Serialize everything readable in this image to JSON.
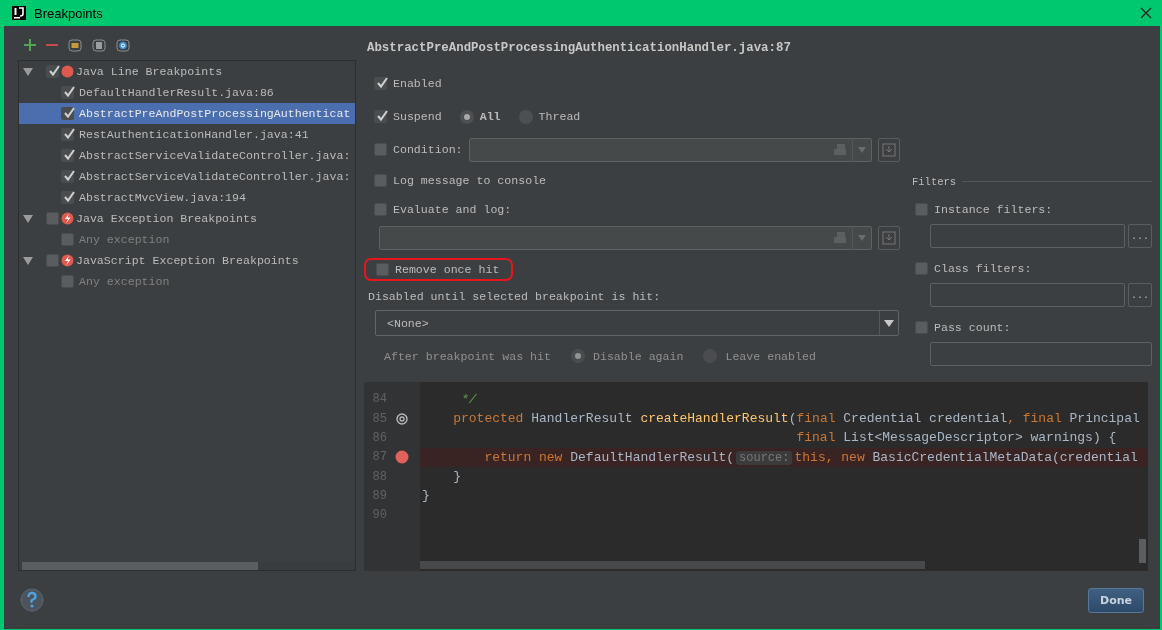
{
  "window": {
    "title": "Breakpoints"
  },
  "tree": [
    {
      "label": "Java Line Breakpoints",
      "kind": "line",
      "checked": true,
      "expanded": true,
      "selected": false,
      "children": [
        {
          "label": "DefaultHandlerResult.java:86",
          "checked": true,
          "selected": false,
          "disabled": false
        },
        {
          "label": "AbstractPreAndPostProcessingAuthenticat",
          "checked": true,
          "selected": true,
          "disabled": false
        },
        {
          "label": "RestAuthenticationHandler.java:41",
          "checked": true,
          "selected": false,
          "disabled": false
        },
        {
          "label": "AbstractServiceValidateController.java:",
          "checked": true,
          "selected": false,
          "disabled": false
        },
        {
          "label": "AbstractServiceValidateController.java:",
          "checked": true,
          "selected": false,
          "disabled": false
        },
        {
          "label": "AbstractMvcView.java:194",
          "checked": true,
          "selected": false,
          "disabled": false
        }
      ]
    },
    {
      "label": "Java Exception Breakpoints",
      "kind": "exception",
      "checked": false,
      "expanded": true,
      "selected": false,
      "children": [
        {
          "label": "Any exception",
          "checked": false,
          "selected": false,
          "disabled": true
        }
      ]
    },
    {
      "label": "JavaScript Exception Breakpoints",
      "kind": "exception",
      "checked": false,
      "expanded": true,
      "selected": false,
      "children": [
        {
          "label": "Any exception",
          "checked": false,
          "selected": false,
          "disabled": true
        }
      ]
    }
  ],
  "props": {
    "header": "AbstractPreAndPostProcessingAuthenticationHandler.java:87",
    "enabled": {
      "label": "Enabled",
      "checked": true
    },
    "suspend": {
      "label": "Suspend",
      "checked": true,
      "options": [
        {
          "label": "All",
          "selected": true
        },
        {
          "label": "Thread",
          "selected": false
        }
      ]
    },
    "condition": {
      "label": "Condition:",
      "checked": false
    },
    "log_message": {
      "label": "Log message to console",
      "checked": false
    },
    "evaluate": {
      "label": "Evaluate and log:",
      "checked": false
    },
    "remove_once_hit": {
      "label": "Remove once hit",
      "checked": false,
      "highlighted": true
    },
    "disabled_until": {
      "label": "Disabled until selected breakpoint is hit:",
      "value": "<None>"
    },
    "after_hit": {
      "label": "After breakpoint was hit",
      "disabled": true,
      "options": [
        {
          "label": "Disable again",
          "selected": true
        },
        {
          "label": "Leave enabled",
          "selected": false
        }
      ]
    },
    "filters": {
      "title": "Filters",
      "items": [
        {
          "label": "Instance filters:",
          "checked": false,
          "button": "..."
        },
        {
          "label": "Class filters:",
          "checked": false,
          "button": "..."
        },
        {
          "label": "Pass count:",
          "checked": false
        }
      ]
    }
  },
  "editor": {
    "lines": [
      {
        "number": "84",
        "kind": "plain",
        "segments": [
          {
            "kind": "comment",
            "text": "     */"
          }
        ]
      },
      {
        "number": "85",
        "kind": "override",
        "segments": [
          {
            "kind": "keyword",
            "text": "    protected "
          },
          {
            "kind": "plain",
            "text": "HandlerResult "
          },
          {
            "kind": "method",
            "text": "createHandlerResult"
          },
          {
            "kind": "plain",
            "text": "("
          },
          {
            "kind": "keyword",
            "text": "final "
          },
          {
            "kind": "plain",
            "text": "Credential credential"
          },
          {
            "kind": "keyword",
            "text": ", final "
          },
          {
            "kind": "plain",
            "text": "Principal"
          }
        ]
      },
      {
        "number": "86",
        "kind": "plain",
        "segments": [
          {
            "kind": "keyword",
            "text": "                                                final "
          },
          {
            "kind": "plain",
            "text": "List<MessageDescriptor> warnings) {"
          }
        ]
      },
      {
        "number": "87",
        "kind": "breakpoint",
        "segments": [
          {
            "kind": "keyword",
            "text": "        return new "
          },
          {
            "kind": "plain",
            "text": "DefaultHandlerResult("
          },
          {
            "kind": "hint",
            "text": "source:"
          },
          {
            "kind": "keyword",
            "text": "this, new "
          },
          {
            "kind": "plain",
            "text": "BasicCredentialMetaData(credential"
          }
        ]
      },
      {
        "number": "88",
        "kind": "plain",
        "segments": [
          {
            "kind": "plain",
            "text": "    }"
          }
        ]
      },
      {
        "number": "89",
        "kind": "plain",
        "segments": [
          {
            "kind": "plain",
            "text": "}"
          }
        ]
      },
      {
        "number": "90",
        "kind": "plain"
      }
    ]
  },
  "footer": {
    "done": "Done"
  }
}
